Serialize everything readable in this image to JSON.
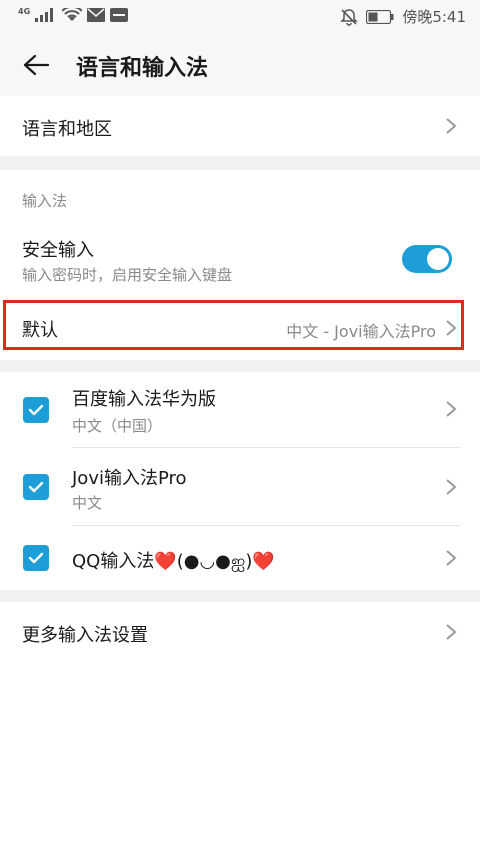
{
  "status_bar": {
    "network": "4G",
    "carrier_time": "傍晚5:41",
    "icons": [
      "signal-icon",
      "wifi-icon",
      "mail-icon",
      "notification-icon",
      "mute-icon",
      "battery-icon"
    ]
  },
  "header": {
    "title": "语言和输入法"
  },
  "language_region": {
    "label": "语言和地区"
  },
  "input_section": {
    "label": "输入法",
    "secure_input": {
      "title": "安全输入",
      "subtitle": "输入密码时，启用安全输入键盘",
      "enabled": true
    },
    "default": {
      "title": "默认",
      "value": "中文 - Jovi输入法Pro"
    }
  },
  "keyboards": [
    {
      "name": "百度输入法华为版",
      "language": "中文（中国）",
      "checked": true
    },
    {
      "name": "Jovi输入法Pro",
      "language": "中文",
      "checked": true
    },
    {
      "name": "QQ输入法❤️(●◡●ஐ)❤️",
      "language": "",
      "checked": true
    }
  ],
  "more_settings": {
    "label": "更多输入法设置"
  },
  "colors": {
    "accent": "#1e9ed8",
    "highlight_border": "#e02a1e",
    "secondary_text": "#8a8a8a",
    "section_gap": "#f2f2f2"
  }
}
